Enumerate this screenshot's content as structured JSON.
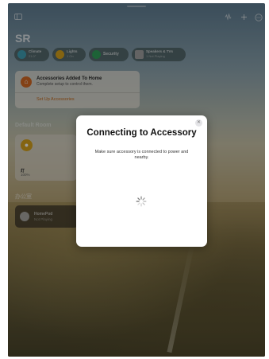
{
  "home": {
    "title": "SR"
  },
  "status_chips": [
    {
      "label": "Climate",
      "value": "21.0°",
      "color": "#3f9fb3"
    },
    {
      "label": "Lights",
      "value": "1 On",
      "color": "#d6a21c"
    },
    {
      "label": "Security",
      "value": "",
      "color": "#2f9e5a"
    },
    {
      "label": "Speakers & TVs",
      "value": "1 Not Playing",
      "color": "#a0a0a0"
    }
  ],
  "accessories_banner": {
    "title": "Accessories Added To Home",
    "subtitle": "Complete setup to control them.",
    "action": "Set Up Accessories"
  },
  "sections": {
    "default_room": "Default Room",
    "other": "办公室"
  },
  "light_tile": {
    "name": "灯",
    "state": "100%"
  },
  "homepod_tile": {
    "name": "HomePod",
    "state": "Not Playing"
  },
  "modal": {
    "title": "Connecting to Accessory",
    "description": "Make sure accessory is connected to power and nearby.",
    "close_glyph": "✕"
  },
  "icons": {
    "sidebar": "sidebar-icon",
    "waveform": "waveform-icon",
    "add": "plus-icon",
    "more": "ellipsis-circle-icon"
  }
}
